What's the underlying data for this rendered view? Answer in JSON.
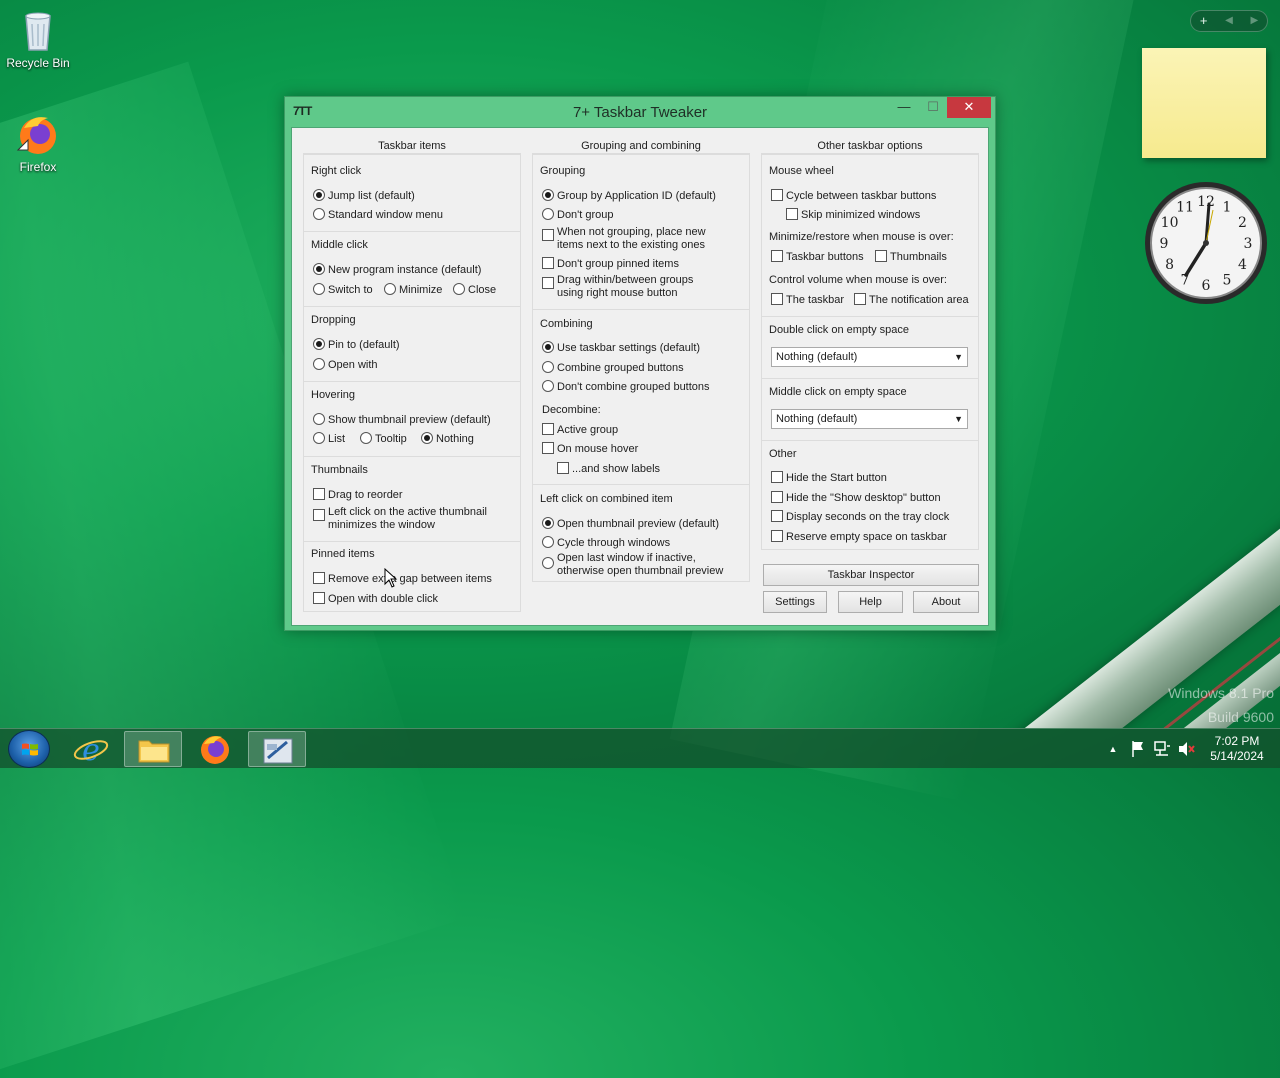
{
  "desktop": {
    "icons": [
      {
        "label": "Recycle Bin",
        "icon": "recycle-bin-icon"
      },
      {
        "label": "Firefox",
        "icon": "firefox-icon"
      }
    ],
    "watermark": {
      "line1": "Windows 8.1 Pro",
      "line2": "Build 9600"
    },
    "gadget_bar": {
      "add": "+",
      "prev": "◀",
      "next": "▶"
    },
    "clock_gadget": {
      "time": "7:02",
      "numbers": [
        "12",
        "1",
        "2",
        "3",
        "4",
        "5",
        "6",
        "7",
        "8",
        "9",
        "10",
        "11"
      ]
    }
  },
  "window": {
    "title": "7+ Taskbar Tweaker",
    "app_icon": "7TT",
    "controls": {
      "minimize": "—",
      "maximize": "☐",
      "close": "✕"
    }
  },
  "col1": {
    "header": "Taskbar items",
    "right_click": {
      "label": "Right click",
      "jump_list": "Jump list (default)",
      "standard_menu": "Standard window menu"
    },
    "middle_click": {
      "label": "Middle click",
      "new_instance": "New program instance (default)",
      "switch_to": "Switch to",
      "minimize": "Minimize",
      "close": "Close"
    },
    "dropping": {
      "label": "Dropping",
      "pin_to": "Pin to (default)",
      "open_with": "Open with"
    },
    "hovering": {
      "label": "Hovering",
      "thumbnail_preview": "Show thumbnail preview (default)",
      "list": "List",
      "tooltip": "Tooltip",
      "nothing": "Nothing"
    },
    "thumbnails": {
      "label": "Thumbnails",
      "drag_reorder": "Drag to reorder",
      "left_click_line1": "Left click on the active thumbnail",
      "left_click_line2": "minimizes the window"
    },
    "pinned": {
      "label": "Pinned items",
      "remove_gap": "Remove extra gap between items",
      "double_click": "Open with double click"
    }
  },
  "col2": {
    "header": "Grouping and combining",
    "grouping": {
      "label": "Grouping",
      "by_app_id": "Group by Application ID (default)",
      "dont_group": "Don't group",
      "not_grouping_line1": "When not grouping, place new",
      "not_grouping_line2": "items next to the existing ones",
      "dont_group_pinned": "Don't group pinned items",
      "drag_line1": "Drag within/between groups",
      "drag_line2": "using right mouse button"
    },
    "combining": {
      "label": "Combining",
      "use_settings": "Use taskbar settings (default)",
      "combine": "Combine grouped buttons",
      "dont_combine": "Don't combine grouped buttons"
    },
    "decombine": {
      "label": "Decombine:",
      "active_group": "Active group",
      "mouse_hover": "On mouse hover",
      "show_labels": "...and show labels"
    },
    "left_click": {
      "label": "Left click on combined item",
      "open_preview": "Open thumbnail preview (default)",
      "cycle": "Cycle through windows",
      "last_line1": "Open last window if inactive,",
      "last_line2": "otherwise open thumbnail preview"
    }
  },
  "col3": {
    "header": "Other taskbar options",
    "mouse_wheel": {
      "label": "Mouse wheel",
      "cycle": "Cycle between taskbar buttons",
      "skip_minimized": "Skip minimized windows",
      "minimize_restore": "Minimize/restore when mouse is over:",
      "taskbar_buttons": "Taskbar buttons",
      "thumbnails": "Thumbnails",
      "control_volume": "Control volume when mouse is over:",
      "the_taskbar": "The taskbar",
      "notification_area": "The notification area"
    },
    "double_click": {
      "label": "Double click on empty space",
      "value": "Nothing (default)"
    },
    "middle_click": {
      "label": "Middle click on empty space",
      "value": "Nothing (default)"
    },
    "other": {
      "label": "Other",
      "hide_start": "Hide the Start button",
      "hide_show_desktop": "Hide the \"Show desktop\" button",
      "display_seconds": "Display seconds on the tray clock",
      "reserve_space": "Reserve empty space on taskbar"
    },
    "buttons": {
      "inspector": "Taskbar Inspector",
      "settings": "Settings",
      "help": "Help",
      "about": "About"
    }
  },
  "taskbar": {
    "buttons": [
      {
        "name": "internet-explorer",
        "icon": "internet-explorer-icon"
      },
      {
        "name": "file-explorer",
        "icon": "folder-icon"
      },
      {
        "name": "firefox",
        "icon": "firefox-icon"
      },
      {
        "name": "7-taskbar-tweaker",
        "icon": "tweaker-icon"
      }
    ],
    "tray": {
      "time": "7:02 PM",
      "date": "5/14/2024",
      "show_hidden": "▲"
    }
  }
}
